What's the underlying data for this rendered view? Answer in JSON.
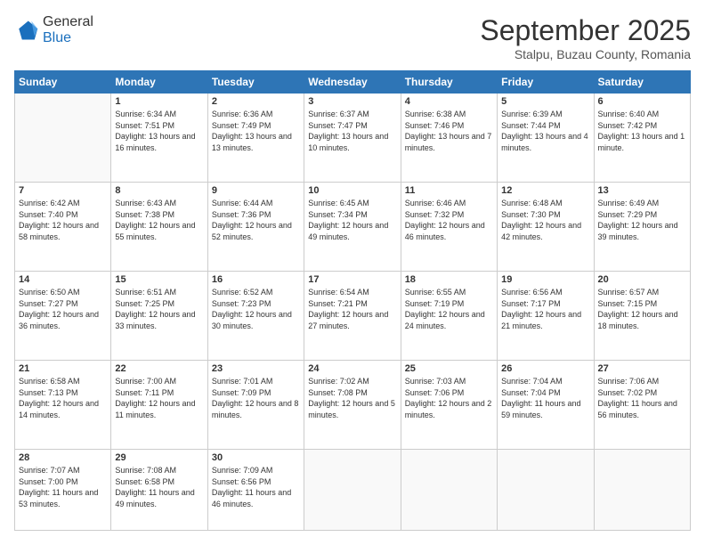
{
  "header": {
    "logo_general": "General",
    "logo_blue": "Blue",
    "month_title": "September 2025",
    "subtitle": "Stalpu, Buzau County, Romania"
  },
  "weekdays": [
    "Sunday",
    "Monday",
    "Tuesday",
    "Wednesday",
    "Thursday",
    "Friday",
    "Saturday"
  ],
  "weeks": [
    [
      {
        "day": null,
        "info": null
      },
      {
        "day": "1",
        "sunrise": "6:34 AM",
        "sunset": "7:51 PM",
        "daylight": "13 hours and 16 minutes."
      },
      {
        "day": "2",
        "sunrise": "6:36 AM",
        "sunset": "7:49 PM",
        "daylight": "13 hours and 13 minutes."
      },
      {
        "day": "3",
        "sunrise": "6:37 AM",
        "sunset": "7:47 PM",
        "daylight": "13 hours and 10 minutes."
      },
      {
        "day": "4",
        "sunrise": "6:38 AM",
        "sunset": "7:46 PM",
        "daylight": "13 hours and 7 minutes."
      },
      {
        "day": "5",
        "sunrise": "6:39 AM",
        "sunset": "7:44 PM",
        "daylight": "13 hours and 4 minutes."
      },
      {
        "day": "6",
        "sunrise": "6:40 AM",
        "sunset": "7:42 PM",
        "daylight": "13 hours and 1 minute."
      }
    ],
    [
      {
        "day": "7",
        "sunrise": "6:42 AM",
        "sunset": "7:40 PM",
        "daylight": "12 hours and 58 minutes."
      },
      {
        "day": "8",
        "sunrise": "6:43 AM",
        "sunset": "7:38 PM",
        "daylight": "12 hours and 55 minutes."
      },
      {
        "day": "9",
        "sunrise": "6:44 AM",
        "sunset": "7:36 PM",
        "daylight": "12 hours and 52 minutes."
      },
      {
        "day": "10",
        "sunrise": "6:45 AM",
        "sunset": "7:34 PM",
        "daylight": "12 hours and 49 minutes."
      },
      {
        "day": "11",
        "sunrise": "6:46 AM",
        "sunset": "7:32 PM",
        "daylight": "12 hours and 46 minutes."
      },
      {
        "day": "12",
        "sunrise": "6:48 AM",
        "sunset": "7:30 PM",
        "daylight": "12 hours and 42 minutes."
      },
      {
        "day": "13",
        "sunrise": "6:49 AM",
        "sunset": "7:29 PM",
        "daylight": "12 hours and 39 minutes."
      }
    ],
    [
      {
        "day": "14",
        "sunrise": "6:50 AM",
        "sunset": "7:27 PM",
        "daylight": "12 hours and 36 minutes."
      },
      {
        "day": "15",
        "sunrise": "6:51 AM",
        "sunset": "7:25 PM",
        "daylight": "12 hours and 33 minutes."
      },
      {
        "day": "16",
        "sunrise": "6:52 AM",
        "sunset": "7:23 PM",
        "daylight": "12 hours and 30 minutes."
      },
      {
        "day": "17",
        "sunrise": "6:54 AM",
        "sunset": "7:21 PM",
        "daylight": "12 hours and 27 minutes."
      },
      {
        "day": "18",
        "sunrise": "6:55 AM",
        "sunset": "7:19 PM",
        "daylight": "12 hours and 24 minutes."
      },
      {
        "day": "19",
        "sunrise": "6:56 AM",
        "sunset": "7:17 PM",
        "daylight": "12 hours and 21 minutes."
      },
      {
        "day": "20",
        "sunrise": "6:57 AM",
        "sunset": "7:15 PM",
        "daylight": "12 hours and 18 minutes."
      }
    ],
    [
      {
        "day": "21",
        "sunrise": "6:58 AM",
        "sunset": "7:13 PM",
        "daylight": "12 hours and 14 minutes."
      },
      {
        "day": "22",
        "sunrise": "7:00 AM",
        "sunset": "7:11 PM",
        "daylight": "12 hours and 11 minutes."
      },
      {
        "day": "23",
        "sunrise": "7:01 AM",
        "sunset": "7:09 PM",
        "daylight": "12 hours and 8 minutes."
      },
      {
        "day": "24",
        "sunrise": "7:02 AM",
        "sunset": "7:08 PM",
        "daylight": "12 hours and 5 minutes."
      },
      {
        "day": "25",
        "sunrise": "7:03 AM",
        "sunset": "7:06 PM",
        "daylight": "12 hours and 2 minutes."
      },
      {
        "day": "26",
        "sunrise": "7:04 AM",
        "sunset": "7:04 PM",
        "daylight": "11 hours and 59 minutes."
      },
      {
        "day": "27",
        "sunrise": "7:06 AM",
        "sunset": "7:02 PM",
        "daylight": "11 hours and 56 minutes."
      }
    ],
    [
      {
        "day": "28",
        "sunrise": "7:07 AM",
        "sunset": "7:00 PM",
        "daylight": "11 hours and 53 minutes."
      },
      {
        "day": "29",
        "sunrise": "7:08 AM",
        "sunset": "6:58 PM",
        "daylight": "11 hours and 49 minutes."
      },
      {
        "day": "30",
        "sunrise": "7:09 AM",
        "sunset": "6:56 PM",
        "daylight": "11 hours and 46 minutes."
      },
      {
        "day": null,
        "info": null
      },
      {
        "day": null,
        "info": null
      },
      {
        "day": null,
        "info": null
      },
      {
        "day": null,
        "info": null
      }
    ]
  ]
}
